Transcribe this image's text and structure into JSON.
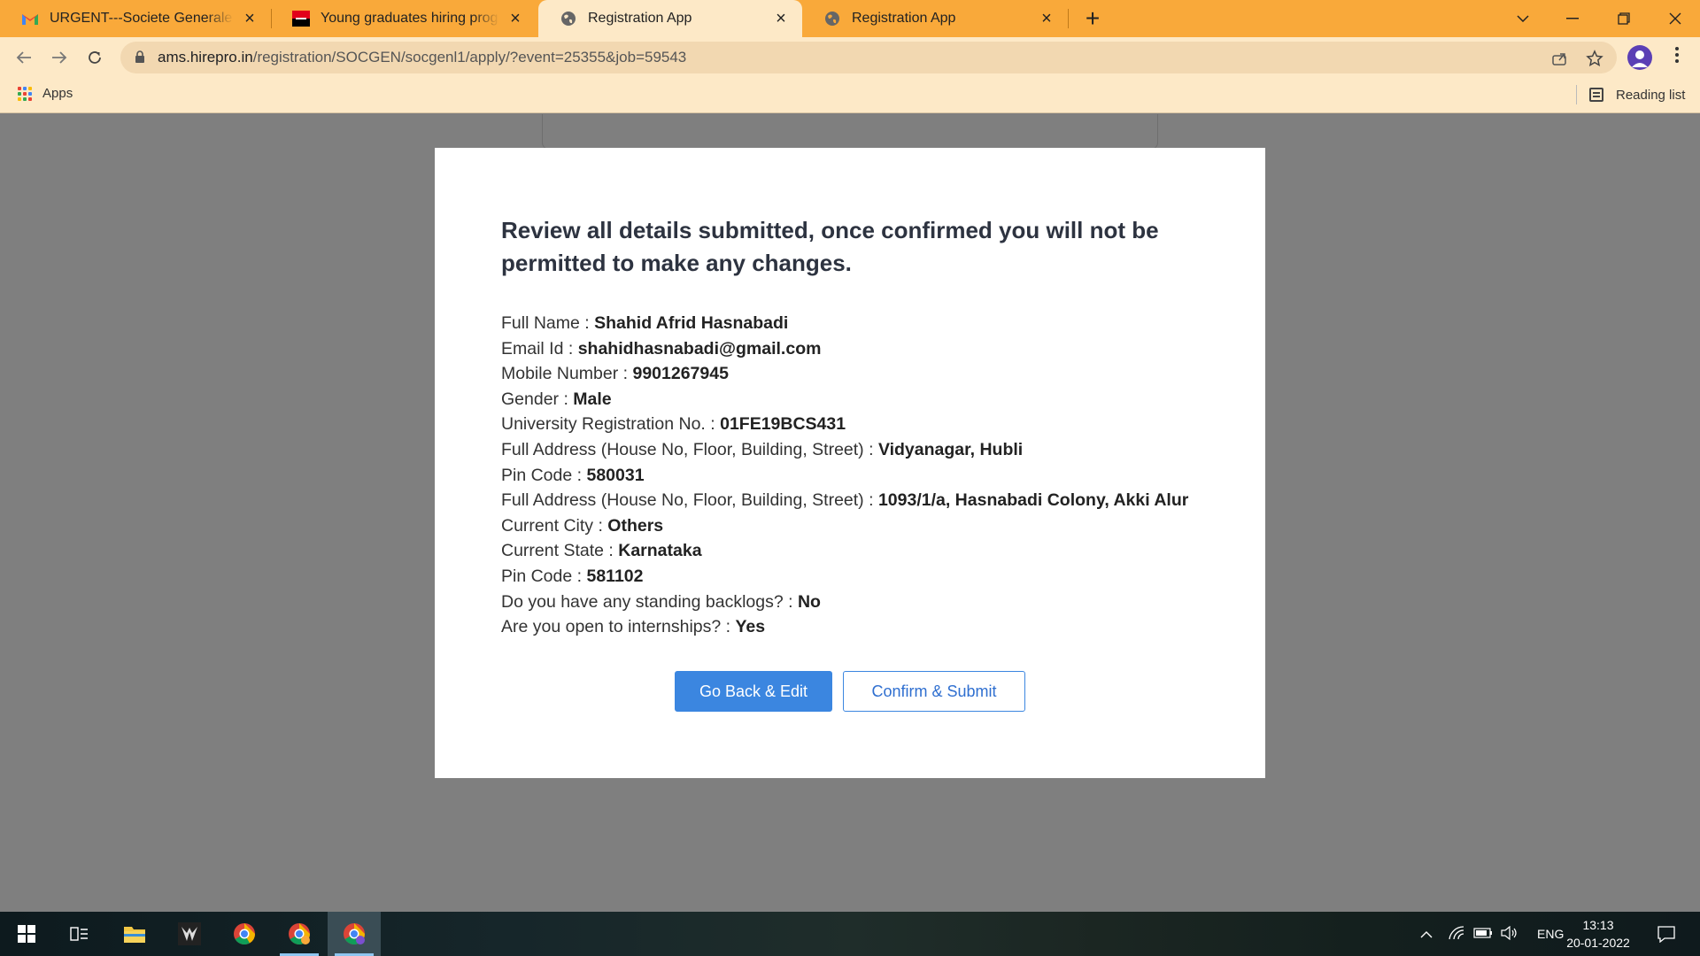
{
  "browser": {
    "tabs": [
      {
        "title": "URGENT---Societe Generale : Reg",
        "icon": "gmail-icon",
        "active": false
      },
      {
        "title": "Young graduates hiring program",
        "icon": "socgen-icon",
        "active": false
      },
      {
        "title": "Registration App",
        "icon": "globe-icon",
        "active": true
      },
      {
        "title": "Registration App",
        "icon": "globe-icon",
        "active": false
      }
    ],
    "url_host": "ams.hirepro.in",
    "url_path": "/registration/SOCGEN/socgenl1/apply/?event=25355&job=59543",
    "bookmarks": {
      "apps_label": "Apps",
      "reading_list_label": "Reading list"
    },
    "accent_color": "#f9a93a"
  },
  "modal": {
    "heading": "Review all details submitted, once confirmed you will not be permitted to make any changes.",
    "fields": [
      {
        "label": "Full Name : ",
        "value": "Shahid Afrid Hasnabadi"
      },
      {
        "label": "Email Id : ",
        "value": "shahidhasnabadi@gmail.com"
      },
      {
        "label": "Mobile Number : ",
        "value": "9901267945"
      },
      {
        "label": "Gender : ",
        "value": "Male"
      },
      {
        "label": "University Registration No. : ",
        "value": "01FE19BCS431"
      },
      {
        "label": "Full Address (House No, Floor, Building, Street) : ",
        "value": "Vidyanagar, Hubli"
      },
      {
        "label": "Pin Code : ",
        "value": "580031"
      },
      {
        "label": "Full Address (House No, Floor, Building, Street) : ",
        "value": "1093/1/a, Hasnabadi Colony, Akki Alur"
      },
      {
        "label": "Current City : ",
        "value": "Others"
      },
      {
        "label": "Current State : ",
        "value": "Karnataka"
      },
      {
        "label": "Pin Code : ",
        "value": "581102"
      },
      {
        "label": "Do you have any standing backlogs? : ",
        "value": "No"
      },
      {
        "label": "Are you open to internships? : ",
        "value": "Yes"
      }
    ],
    "back_button": "Go Back & Edit",
    "confirm_button": "Confirm & Submit",
    "primary_color": "#3b86e0"
  },
  "taskbar": {
    "language": "ENG",
    "time": "13:13",
    "date": "20-01-2022"
  }
}
